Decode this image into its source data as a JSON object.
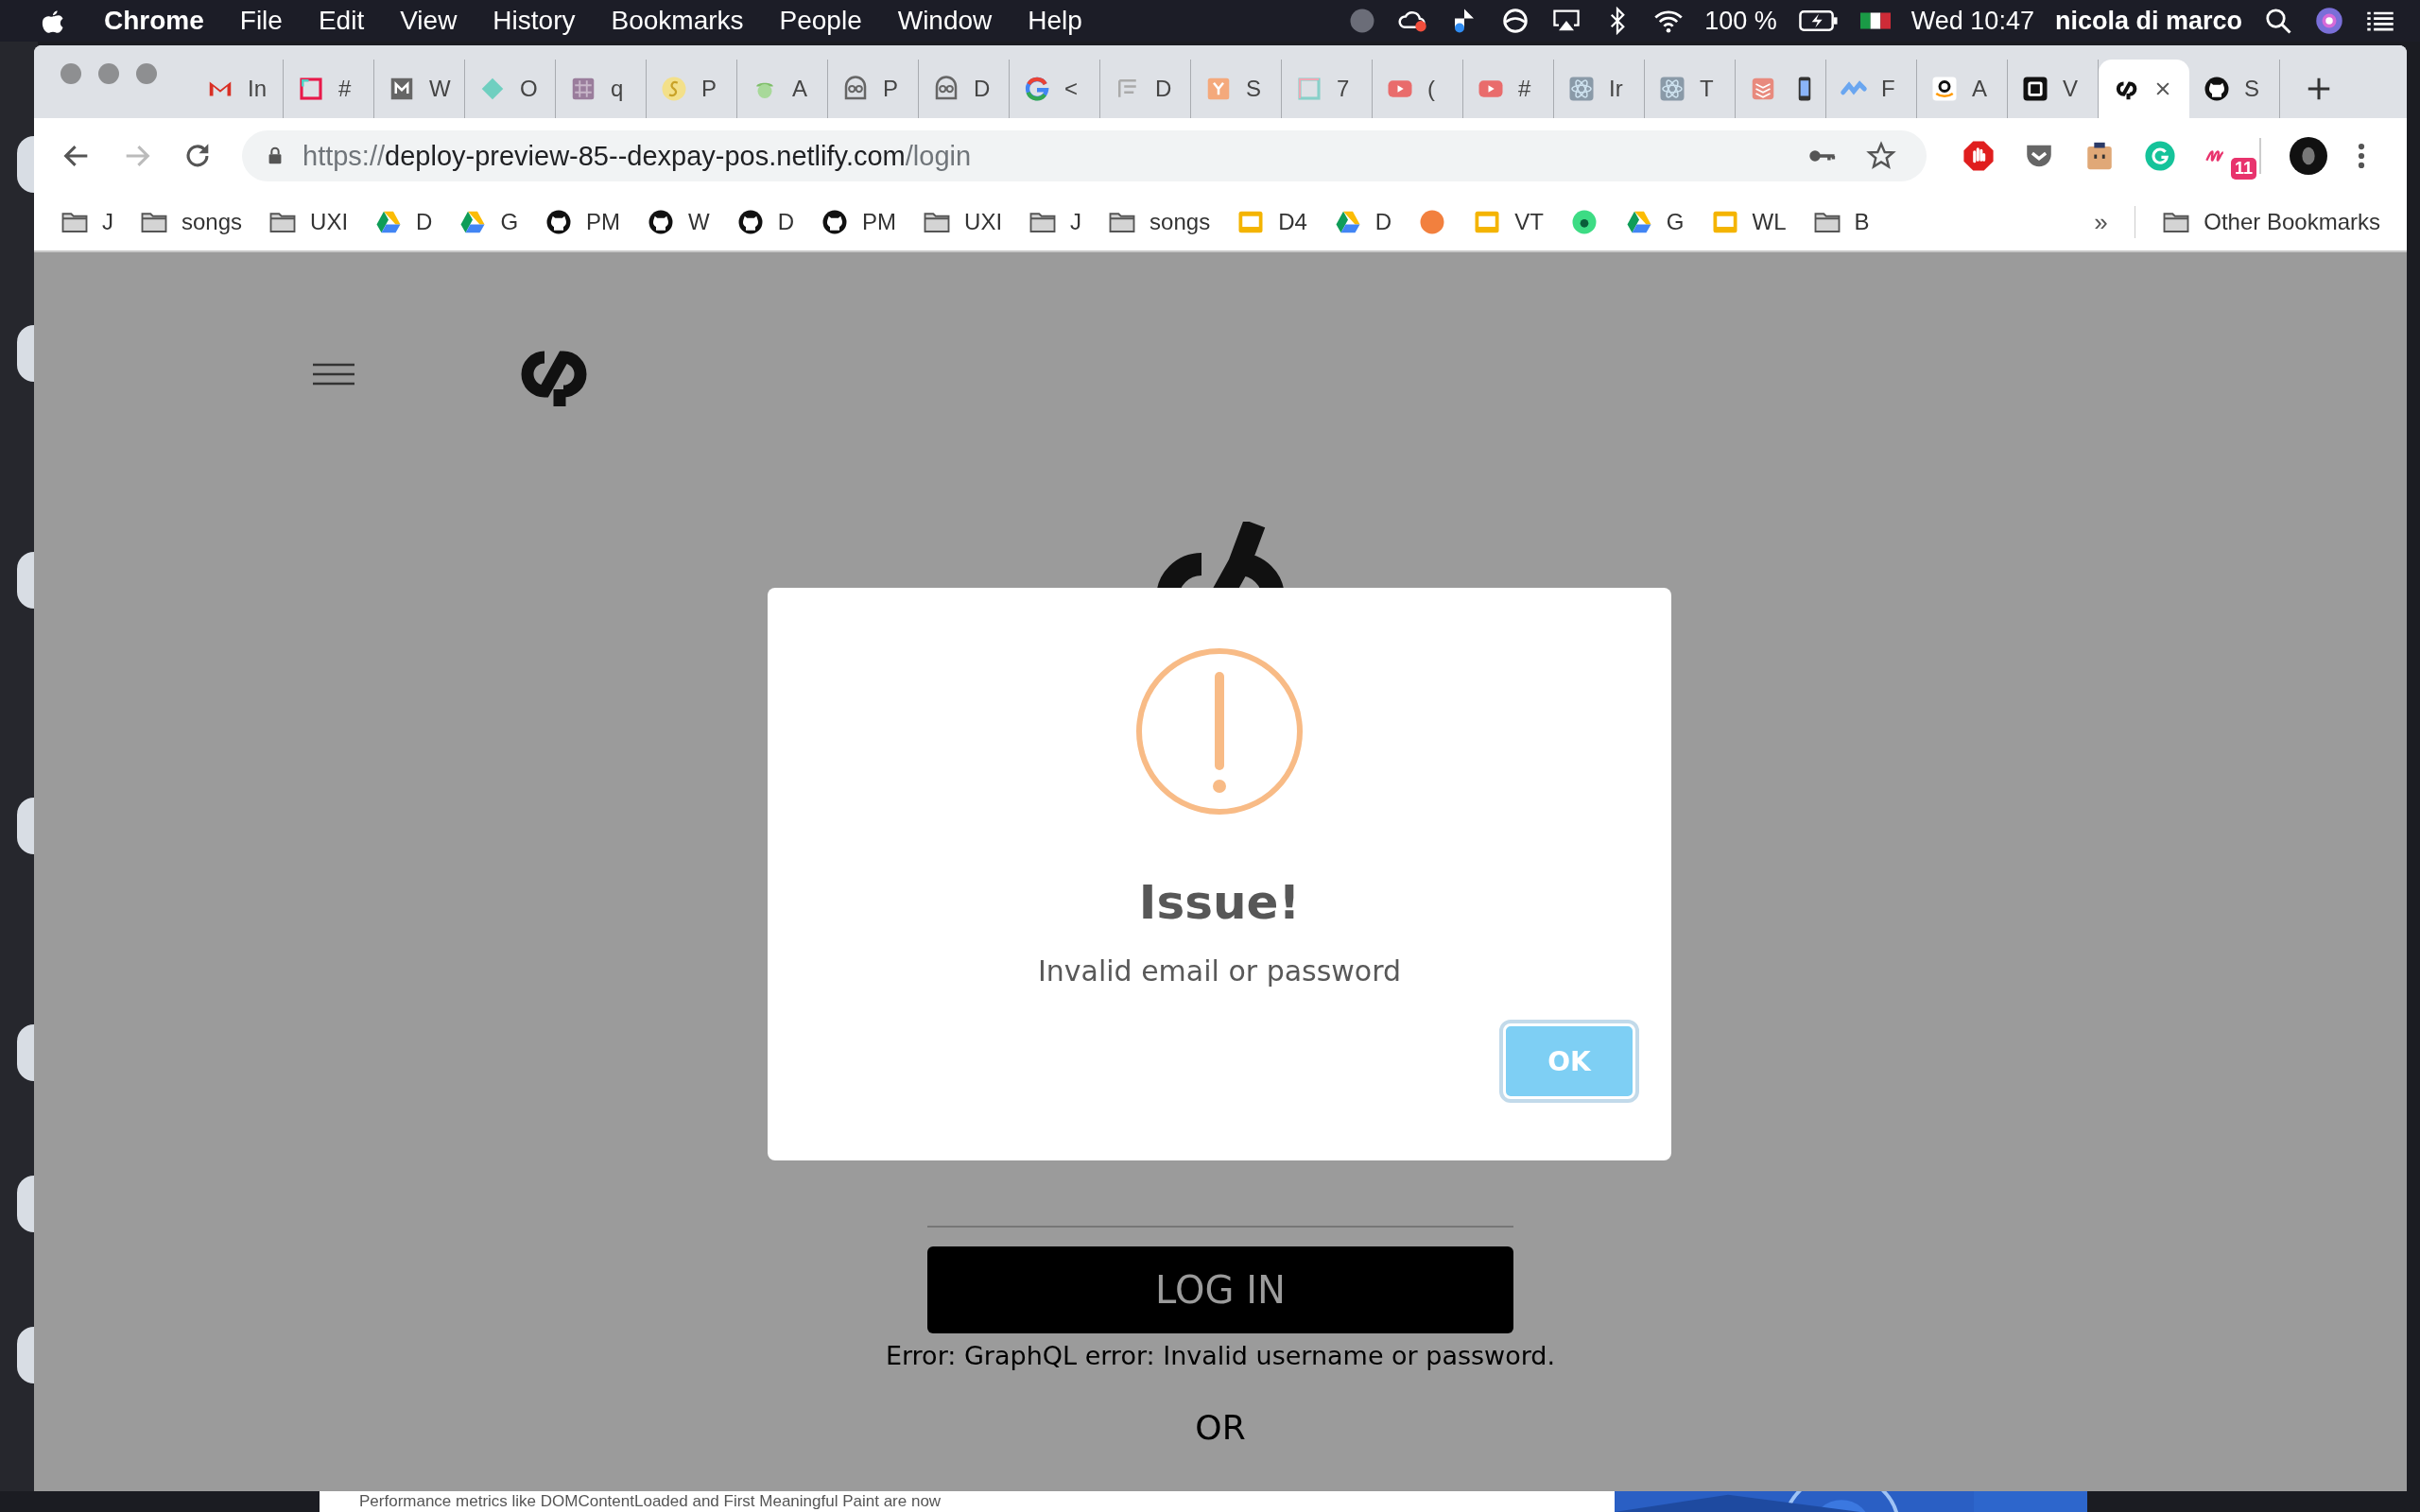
{
  "menu_bar": {
    "app": "Chrome",
    "menus": [
      "File",
      "Edit",
      "View",
      "History",
      "Bookmarks",
      "People",
      "Window",
      "Help"
    ],
    "battery": "100 %",
    "clock": "Wed 10:47",
    "user": "nicola di marco"
  },
  "tabs": [
    {
      "title": "In",
      "selected": false
    },
    {
      "title": "#",
      "selected": false
    },
    {
      "title": "W",
      "selected": false
    },
    {
      "title": "O",
      "selected": false
    },
    {
      "title": "q",
      "selected": false
    },
    {
      "title": "P",
      "selected": false
    },
    {
      "title": "A",
      "selected": false
    },
    {
      "title": "P",
      "selected": false
    },
    {
      "title": "D",
      "selected": false
    },
    {
      "title": "<",
      "selected": false
    },
    {
      "title": "D",
      "selected": false
    },
    {
      "title": "S",
      "selected": false
    },
    {
      "title": "7",
      "selected": false
    },
    {
      "title": "(",
      "selected": false
    },
    {
      "title": "#",
      "selected": false
    },
    {
      "title": "Ir",
      "selected": false
    },
    {
      "title": "T",
      "selected": false
    },
    {
      "selected": false
    },
    {
      "title": "F",
      "selected": false
    },
    {
      "title": "A",
      "selected": false
    },
    {
      "title": "V",
      "selected": false
    },
    {
      "selected": true
    },
    {
      "title": "S",
      "selected": false
    }
  ],
  "toolbar": {
    "url": {
      "scheme": "https://",
      "host": "deploy-preview-85--dexpay-pos.netlify.com",
      "path": "/login"
    },
    "extension_badge": "11"
  },
  "bookmarks": [
    {
      "kind": "folder",
      "label": "J"
    },
    {
      "kind": "folder",
      "label": "songs"
    },
    {
      "kind": "folder",
      "label": "UXI"
    },
    {
      "kind": "link",
      "label": "D"
    },
    {
      "kind": "link",
      "label": "G"
    },
    {
      "kind": "link",
      "label": "PM"
    },
    {
      "kind": "link",
      "label": "W"
    },
    {
      "kind": "link",
      "label": "D"
    },
    {
      "kind": "link",
      "label": "PM"
    },
    {
      "kind": "folder",
      "label": "UXI"
    },
    {
      "kind": "folder",
      "label": "J"
    },
    {
      "kind": "folder",
      "label": "songs"
    },
    {
      "kind": "link",
      "label": "D4"
    },
    {
      "kind": "link",
      "label": "D"
    },
    {
      "kind": "link"
    },
    {
      "kind": "link",
      "label": "VT"
    },
    {
      "kind": "link"
    },
    {
      "kind": "link",
      "label": "G"
    },
    {
      "kind": "link",
      "label": "WL"
    },
    {
      "kind": "folder",
      "label": "B"
    }
  ],
  "bookmarks_more": "»",
  "other_bookmarks": "Other Bookmarks",
  "dialog": {
    "title": "Issue!",
    "message": "Invalid email or password",
    "button": "OK"
  },
  "login": {
    "button": "LOG IN",
    "error": "Error: GraphQL error: Invalid username or password.",
    "or": "OR"
  },
  "background_window": {
    "text": "Performance metrics like DOMContentLoaded and First Meaningful Paint are now"
  }
}
